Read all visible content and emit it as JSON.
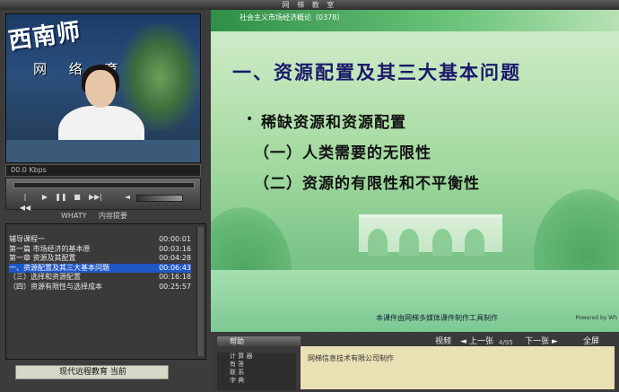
{
  "window": {
    "title": "网 梯 教 室"
  },
  "video": {
    "logo_text": "西南师",
    "sub_text": "网 络 育",
    "bitrate": "00.0 Kbps"
  },
  "player": {
    "buttons": [
      "|◀◀",
      "▶",
      "❚❚",
      "■",
      "▶▶|"
    ]
  },
  "panel": {
    "brand": "WHATY",
    "title": "内容提要"
  },
  "contents": [
    {
      "label": "辅导课程一",
      "time": "00:00:01",
      "selected": false
    },
    {
      "label": "第一篇  市场经济的基本原",
      "time": "00:03:16",
      "selected": false
    },
    {
      "label": "第一章  资源及其配置",
      "time": "00:04:28",
      "selected": false
    },
    {
      "label": "一、资源配置及其三大基本问题",
      "time": "00:06:43",
      "selected": true
    },
    {
      "label": "（三）选择和资源配置",
      "time": "00:16:18",
      "selected": false
    },
    {
      "label": "（四）资源有限性与选择成本",
      "time": "00:25:57",
      "selected": false
    }
  ],
  "status": {
    "label": "现代远程教育",
    "suffix": "当前"
  },
  "slide": {
    "course": "社会主义市场经济概论（0378）",
    "heading": "一、资源配置及其三大基本问题",
    "bullet": "•",
    "line1": "稀缺资源和资源配置",
    "line2": "（一）人类需要的无限性",
    "line3": "（二）资源的有限性和不平衡性",
    "footer": "本课件由网梯多媒体课件制作工具制作",
    "powered": "Powered by Wh"
  },
  "toolbar": {
    "help": "帮助",
    "video": "视频",
    "prev": "上一张",
    "page": "4/95",
    "next": "下一张",
    "fullscreen": "全屏"
  },
  "sidebar_labels": [
    "计 算 器",
    "有    答",
    "联    系",
    "字    典"
  ],
  "info": {
    "text": "网梯信息技术有限公司制作"
  },
  "colors": {
    "selection": "#1f57c6",
    "heading": "#1a1a6a",
    "slide_bg": "#b7e2b0"
  }
}
